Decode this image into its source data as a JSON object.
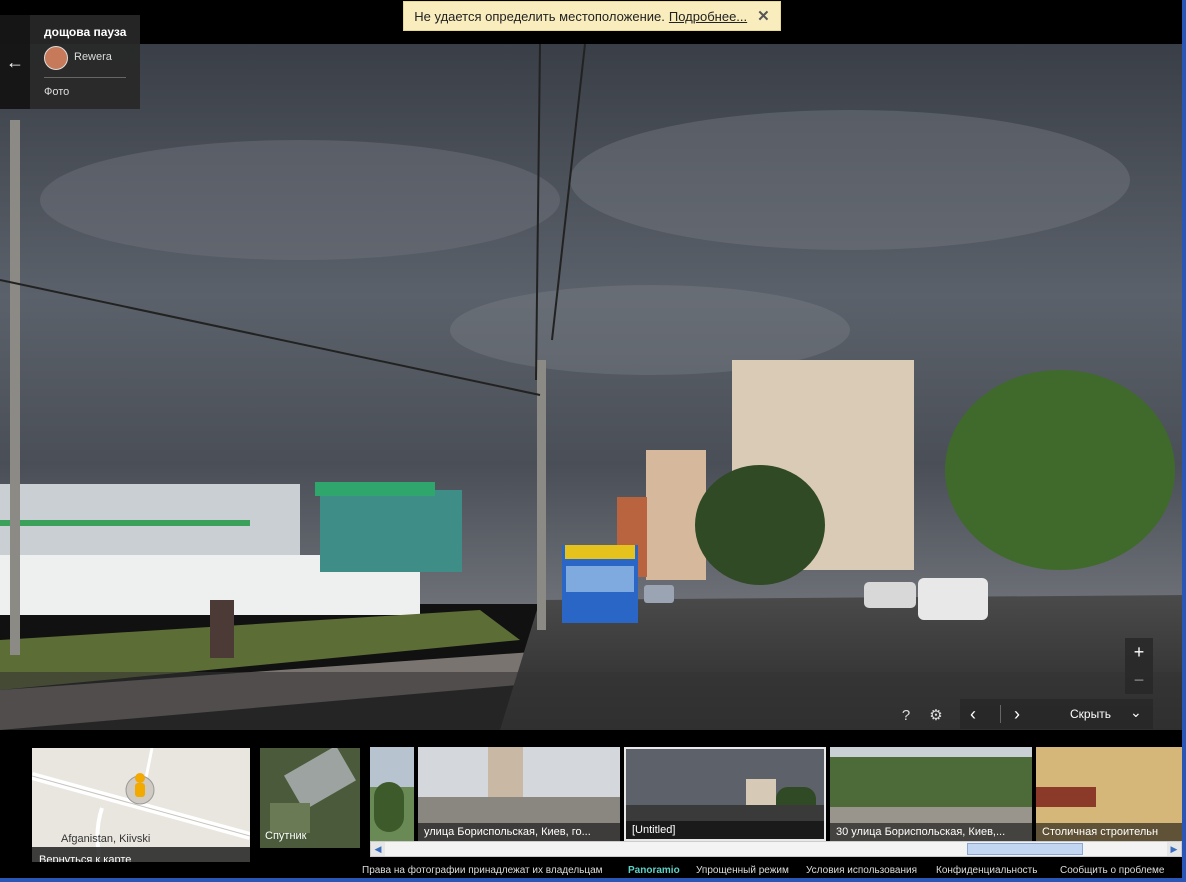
{
  "notice": {
    "text": "Не удается определить местоположение.",
    "link": "Подробнее...",
    "close": "✕"
  },
  "photo_card": {
    "title": "дощова пауза",
    "author": "Rewera",
    "type": "Фото",
    "back": "←"
  },
  "zoom": {
    "plus": "+",
    "minus": "−"
  },
  "controls": {
    "help": "?",
    "settings": "⚙"
  },
  "navbar": {
    "prev": "‹",
    "next": "›",
    "hide": "Скрыть",
    "collapse": "⌄"
  },
  "minimap": {
    "place": "Afganistan, Kiivski",
    "back_label": "Вернуться к карте"
  },
  "satellite": {
    "label": "Спутник"
  },
  "thumbnails": [
    {
      "caption": ""
    },
    {
      "caption": "улица Бориспольская, Киев, го..."
    },
    {
      "caption": "[Untitled]"
    },
    {
      "caption": "30 улица Бориспольская, Киев,..."
    },
    {
      "caption": "Столичная строительн"
    }
  ],
  "footer": {
    "rights": "Права на фотографии принадлежат их владельцам",
    "brand": "Panoramio",
    "simple_mode": "Упрощенный режим",
    "terms": "Условия использования",
    "privacy": "Конфиденциальность",
    "report": "Сообщить о проблеме"
  }
}
